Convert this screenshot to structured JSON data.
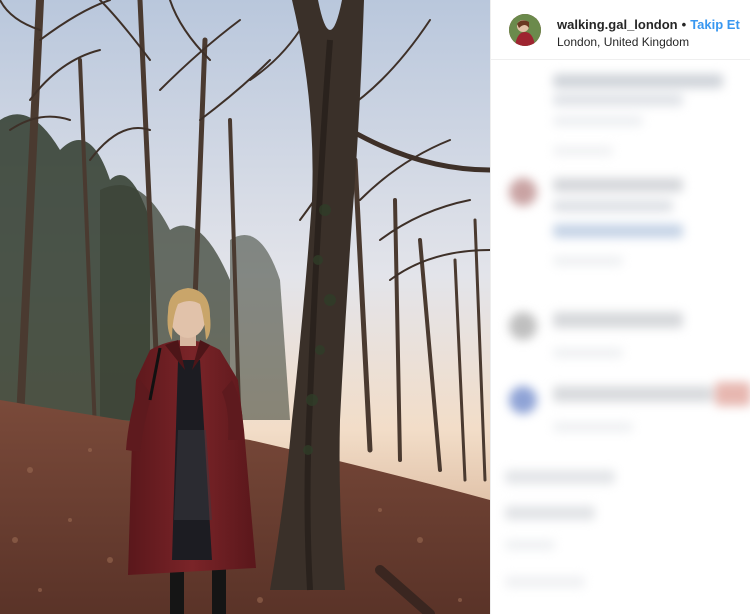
{
  "post": {
    "username": "walking.gal_london",
    "separator": "•",
    "follow_label": "Takip Et",
    "location": "London, United Kingdom"
  },
  "photo": {
    "subject": "woman-in-forest",
    "icon": "photo"
  },
  "comments": {
    "state": "blurred"
  },
  "colors": {
    "follow": "#3897f0",
    "text": "#262626",
    "coat": "#6e1f22"
  }
}
